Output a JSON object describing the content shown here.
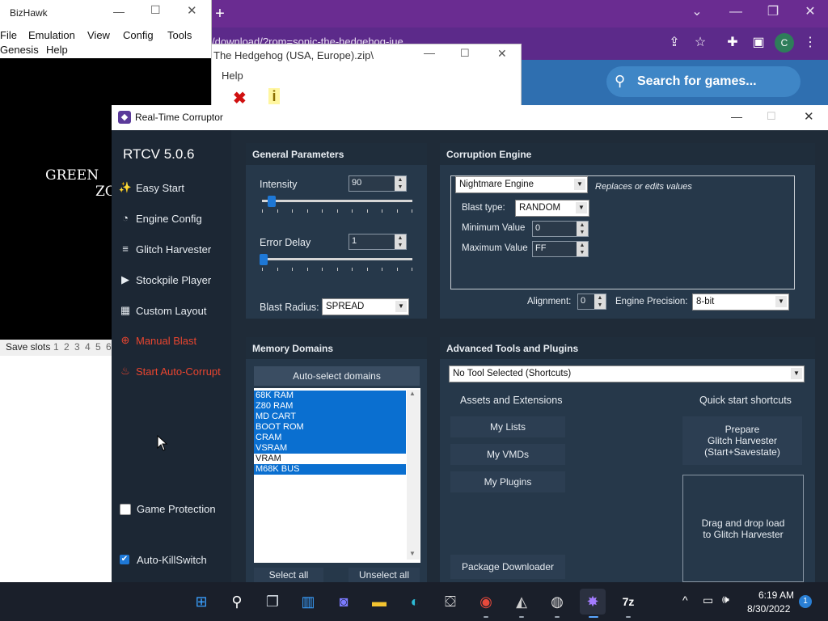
{
  "browser": {
    "url_fragment": "/download/?rom=sonic-the-hedgehog-iue",
    "search_placeholder": "Search for games...",
    "profile_initial": "C",
    "new_tab": "+"
  },
  "bizhawk": {
    "title": "BizHawk",
    "menu_row1": [
      "File",
      "Emulation",
      "View",
      "Config",
      "Tools"
    ],
    "menu_row2": [
      "Genesis",
      "Help"
    ],
    "screen_text": "GREEN",
    "screen_text2": "ZO",
    "save_slots_label": "Save slots",
    "save_slots": [
      "1",
      "2",
      "3",
      "4",
      "5",
      "6"
    ]
  },
  "archive": {
    "title": "The Hedgehog (USA, Europe).zip\\",
    "menu": "Help",
    "icon_x": "✖",
    "icon_info": "i"
  },
  "rtc": {
    "title": "Real-Time Corruptor",
    "version": "RTCV 5.0.6",
    "sidebar": [
      {
        "label": "Easy Start",
        "icon": "magic-wand-icon",
        "glyph": "✨",
        "red": false
      },
      {
        "label": "Engine Config",
        "icon": "gauge-icon",
        "glyph": "◔",
        "red": false
      },
      {
        "label": "Glitch Harvester",
        "icon": "layers-icon",
        "glyph": "≡",
        "red": false
      },
      {
        "label": "Stockpile Player",
        "icon": "play-icon",
        "glyph": "▶",
        "red": false
      },
      {
        "label": "Custom Layout",
        "icon": "grid-icon",
        "glyph": "▦",
        "red": false
      },
      {
        "label": "Manual Blast",
        "icon": "crosshair-icon",
        "glyph": "⊕",
        "red": true
      },
      {
        "label": "Start Auto-Corrupt",
        "icon": "fire-icon",
        "glyph": "♨",
        "red": true
      }
    ],
    "game_protection": {
      "label": "Game Protection",
      "checked": false
    },
    "auto_killswitch": {
      "label": "Auto-KillSwitch",
      "checked": true
    },
    "general": {
      "header": "General Parameters",
      "intensity_label": "Intensity",
      "intensity_value": "90",
      "intensity_slider": 0.04,
      "error_delay_label": "Error Delay",
      "error_delay_value": "1",
      "error_delay_slider": 0.0,
      "blast_radius_label": "Blast Radius:",
      "blast_radius_value": "SPREAD"
    },
    "engine": {
      "header": "Corruption Engine",
      "engine_value": "Nightmare Engine",
      "engine_desc": "Replaces or edits values",
      "blast_type_label": "Blast type:",
      "blast_type_value": "RANDOM",
      "min_label": "Minimum Value",
      "min_value": "0",
      "max_label": "Maximum Value",
      "max_value": "FF",
      "alignment_label": "Alignment:",
      "alignment_value": "0",
      "precision_label": "Engine Precision:",
      "precision_value": "8-bit"
    },
    "memory": {
      "header": "Memory Domains",
      "auto_select": "Auto-select domains",
      "domains": [
        {
          "name": "68K RAM",
          "selected": true
        },
        {
          "name": "Z80 RAM",
          "selected": true
        },
        {
          "name": "MD CART",
          "selected": true
        },
        {
          "name": "BOOT ROM",
          "selected": true
        },
        {
          "name": "CRAM",
          "selected": true
        },
        {
          "name": "VSRAM",
          "selected": true
        },
        {
          "name": "VRAM",
          "selected": false
        },
        {
          "name": "M68K BUS",
          "selected": true
        }
      ],
      "select_all": "Select all",
      "unselect_all": "Unselect all"
    },
    "advanced": {
      "header": "Advanced Tools and Plugins",
      "tool_value": "No Tool Selected (Shortcuts)",
      "assets_header": "Assets and Extensions",
      "quick_header": "Quick start shortcuts",
      "my_lists": "My Lists",
      "my_vmds": "My VMDs",
      "my_plugins": "My Plugins",
      "package_downloader": "Package Downloader",
      "prepare_line1": "Prepare",
      "prepare_line2": "Glitch Harvester",
      "prepare_line3": "(Start+Savestate)",
      "drop_line1": "Drag and drop load",
      "drop_line2": "to Glitch Harvester"
    }
  },
  "taskbar": {
    "time": "6:19 AM",
    "date": "8/30/2022",
    "notifications": "1"
  },
  "colors": {
    "chrome_purple": "#6a2c91",
    "rtc_bg": "#1f2b38",
    "panel_bg": "#26384a",
    "accent_red": "#e8452f",
    "selection_blue": "#0a6fd0"
  }
}
